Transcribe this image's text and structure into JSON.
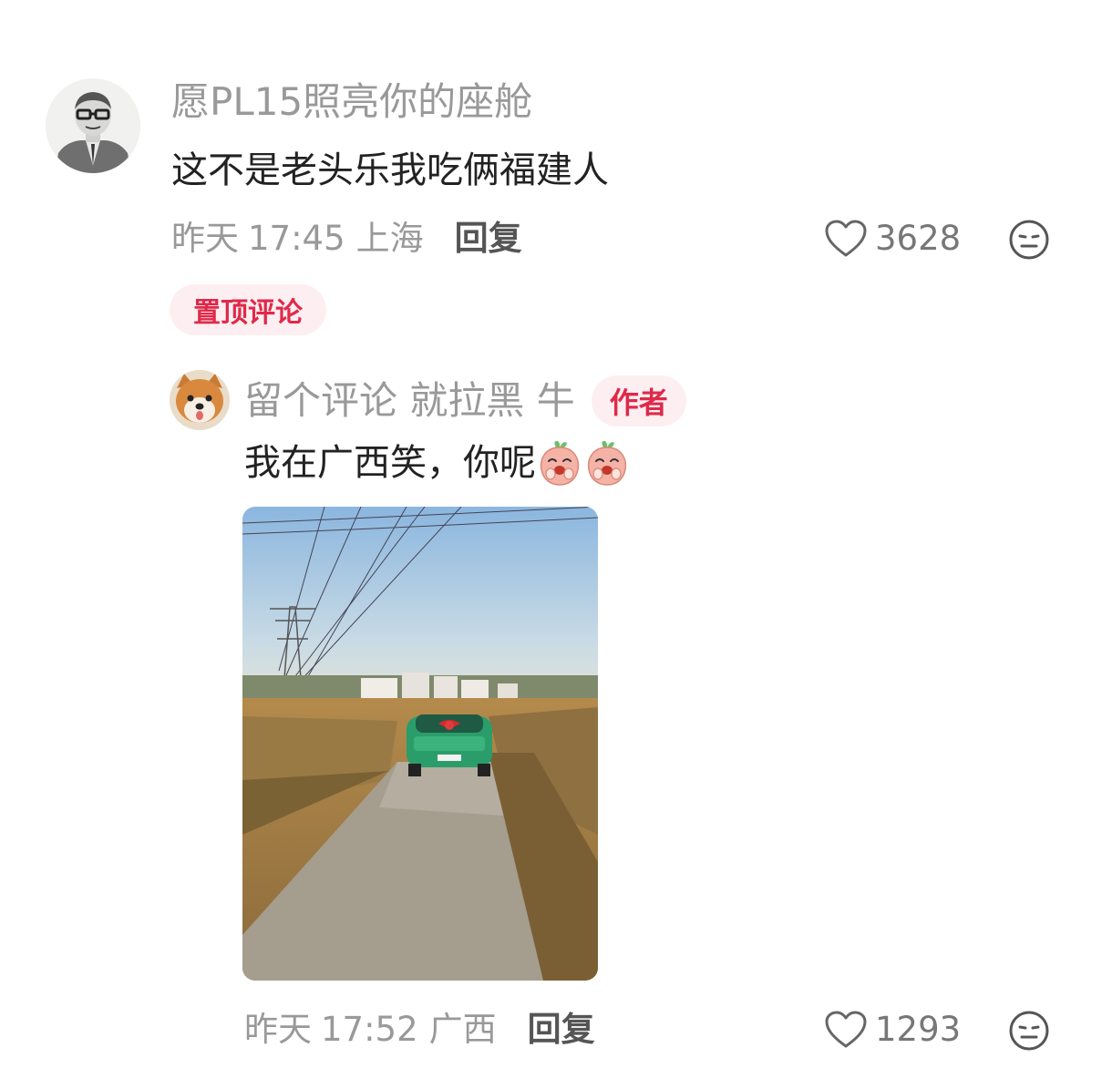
{
  "colors": {
    "accent": "#e0294a",
    "pill_bg": "#fdeff1",
    "username": "#999999",
    "text": "#222222"
  },
  "comment": {
    "username": "愿PL15照亮你的座舱",
    "avatar_icon": "man-with-glasses-portrait",
    "text": "这不是老头乐我吃俩福建人",
    "date": "昨天",
    "time": "17:45",
    "location": "上海",
    "reply_label": "回复",
    "likes": "3628",
    "pinned_label": "置顶评论"
  },
  "reply": {
    "username": "留个评论 就拉黑 牛",
    "avatar_icon": "shiba-dog-avatar",
    "author_badge": "作者",
    "text": "我在广西笑，你呢",
    "emoji": [
      "peach-laugh-emoji",
      "peach-laugh-emoji"
    ],
    "image_icon": "green-car-on-country-road-photo",
    "date": "昨天",
    "time": "17:52",
    "location": "广西",
    "reply_label": "回复",
    "likes": "1293"
  }
}
